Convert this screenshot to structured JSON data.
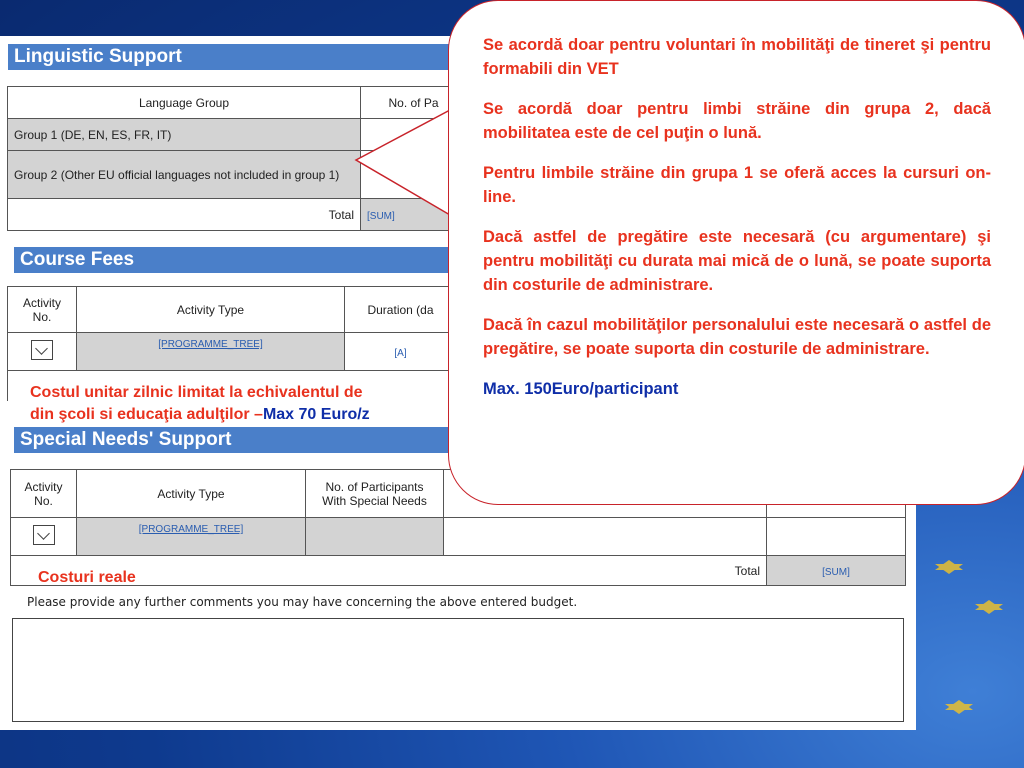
{
  "linguistic": {
    "title": "Linguistic Support",
    "col_group": "Language Group",
    "col_participants": "No. of Pa",
    "rows": [
      "Group 1 (DE, EN, ES, FR, IT)",
      "Group 2 (Other EU official languages not included in group 1)"
    ],
    "total_label": "Total",
    "sum": "[SUM]"
  },
  "course": {
    "title": "Course Fees",
    "col_activity_no": "Activity No.",
    "col_activity_type": "Activity Type",
    "col_duration": "Duration (da",
    "tree_link": "[PROGRAMME_TREE]",
    "cell_a": "[A]"
  },
  "note_course": {
    "line1": "Costul unitar zilnic limitat la echivalentul de",
    "line2_prefix": "din şcoli si educaţia adulţilor –",
    "line2_max": "Max 70 Euro/z"
  },
  "special": {
    "title": "Special Needs' Support",
    "col_activity_no": "Activity No.",
    "col_activity_type": "Activity Type",
    "col_participants": "No. of Participants With Special Needs",
    "tree_link": "[PROGRAMME_TREE]",
    "total_label": "Total",
    "sum": "[SUM]"
  },
  "note_costs": "Costuri reale",
  "comments": {
    "prompt": "Please provide any further comments you may have concerning the above entered budget."
  },
  "bubble": {
    "p1": "Se acordă doar pentru voluntari în mobilităţi de tineret şi pentru formabili din VET",
    "p2": "Se acordă doar pentru limbi străine din grupa 2, dacă mobilitatea este de cel puţin o lună.",
    "p3": "Pentru limbile străine din grupa 1 se oferă acces la cursuri on-line.",
    "p4": "Dacă astfel de pregătire este necesară (cu argumentare) şi pentru mobilităţi cu durata mai mică de o lună, se poate suporta din costurile de administrare.",
    "p5": "Dacă în cazul mobilităţilor personalului este necesară o astfel de pregătire, se poate suporta din costurile de administrare.",
    "p6": "Max. 150Euro/participant"
  },
  "colors": {
    "header_bg": "#4a7fc9",
    "note_red": "#e8321e",
    "note_blue": "#0f2ea8",
    "link": "#2a5db0"
  },
  "icons": {
    "tree_icon": "expand-down-icon"
  }
}
